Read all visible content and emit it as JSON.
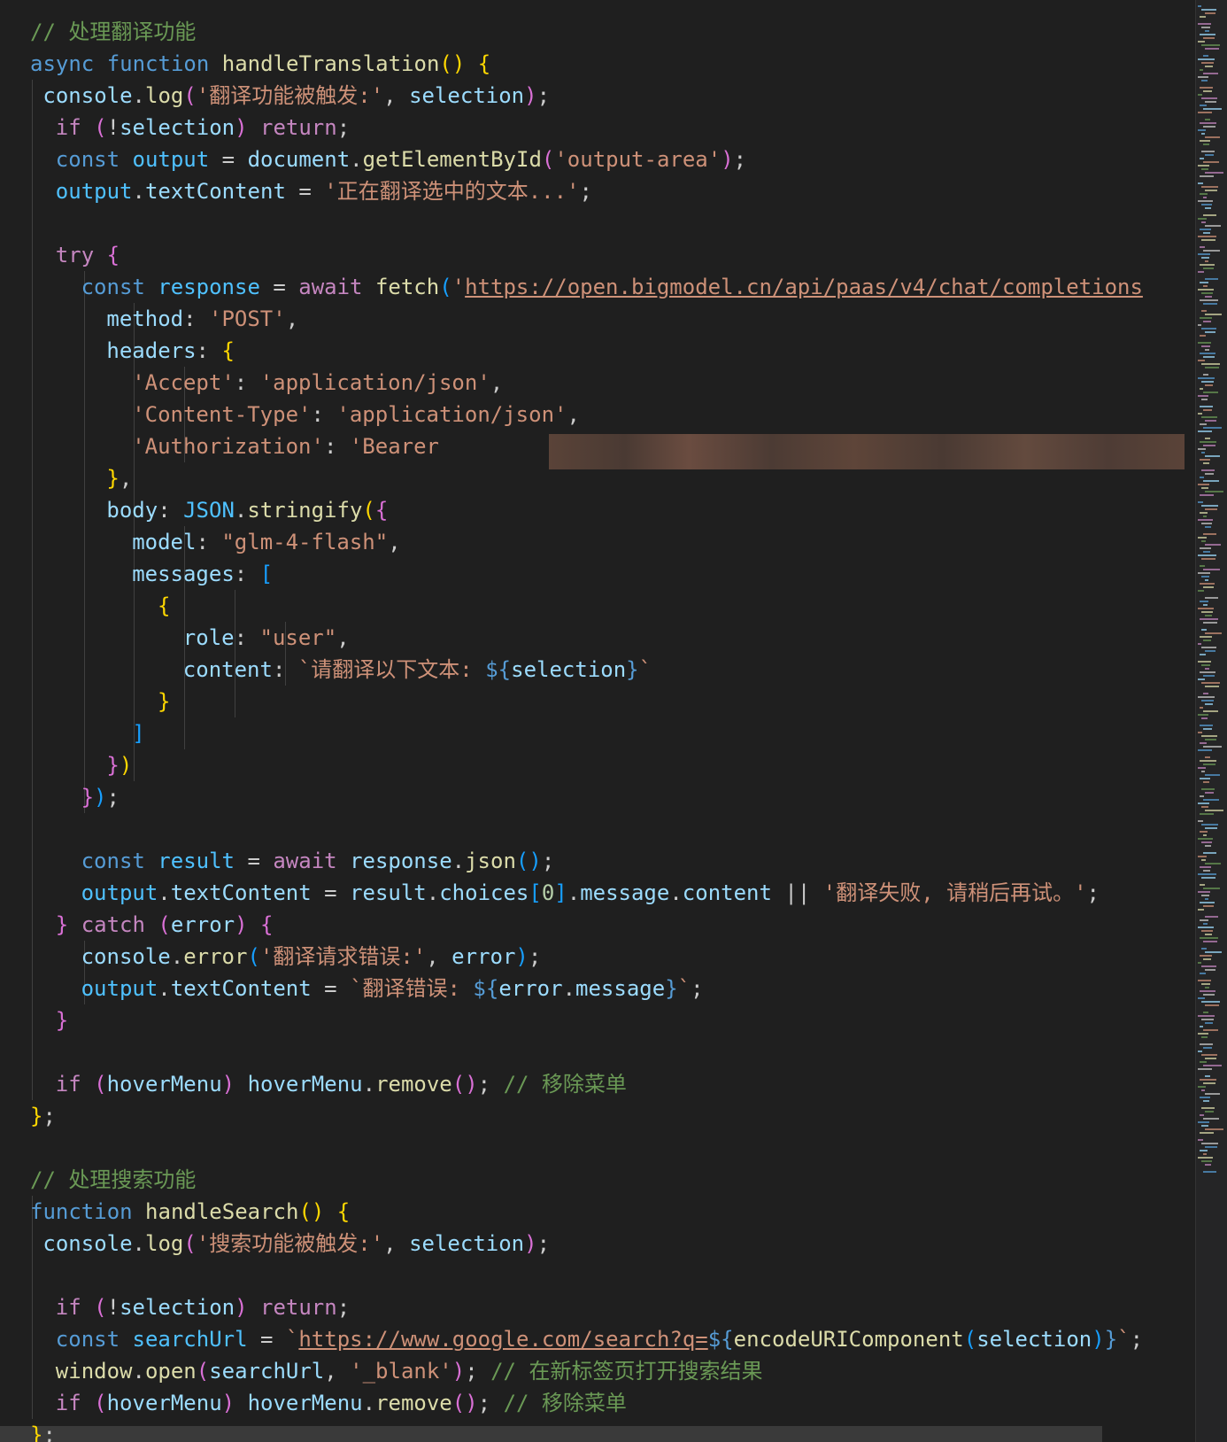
{
  "lines": [
    [
      [
        "com",
        "// 处理翻译功能"
      ]
    ],
    [
      [
        "kw",
        "async "
      ],
      [
        "kw",
        "function "
      ],
      [
        "fn",
        "handleTranslation"
      ],
      [
        "b1",
        "() {"
      ]
    ],
    [
      [
        "var",
        "console"
      ],
      [
        "p",
        "."
      ],
      [
        "fn",
        "log"
      ],
      [
        "b2",
        "("
      ],
      [
        "str",
        "'翻译功能被触发:'"
      ],
      [
        "p",
        ", "
      ],
      [
        "var",
        "selection"
      ],
      [
        "b2",
        ")"
      ],
      [
        "p",
        ";"
      ]
    ],
    [
      [
        "ctl",
        "if "
      ],
      [
        "b2",
        "("
      ],
      [
        "p",
        "!"
      ],
      [
        "var",
        "selection"
      ],
      [
        "b2",
        ")"
      ],
      [
        "ctl",
        " return"
      ],
      [
        "p",
        ";"
      ]
    ],
    [
      [
        "kw",
        "const "
      ],
      [
        "const",
        "output"
      ],
      [
        "p",
        " = "
      ],
      [
        "var",
        "document"
      ],
      [
        "p",
        "."
      ],
      [
        "fn",
        "getElementById"
      ],
      [
        "b2",
        "("
      ],
      [
        "str",
        "'output-area'"
      ],
      [
        "b2",
        ")"
      ],
      [
        "p",
        ";"
      ]
    ],
    [
      [
        "const",
        "output"
      ],
      [
        "p",
        "."
      ],
      [
        "var",
        "textContent"
      ],
      [
        "p",
        " = "
      ],
      [
        "str",
        "'正在翻译选中的文本...'"
      ],
      [
        "p",
        ";"
      ]
    ],
    [],
    [
      [
        "ctl",
        "try "
      ],
      [
        "b2",
        "{"
      ]
    ],
    [
      [
        "kw",
        "const "
      ],
      [
        "const",
        "response"
      ],
      [
        "p",
        " = "
      ],
      [
        "ctl",
        "await "
      ],
      [
        "fn",
        "fetch"
      ],
      [
        "b3",
        "("
      ],
      [
        "str",
        "'"
      ],
      [
        "url",
        "https://open.bigmodel.cn/api/paas/v4/chat/completions"
      ]
    ],
    [
      [
        "var",
        "method"
      ],
      [
        "p",
        ": "
      ],
      [
        "str",
        "'POST'"
      ],
      [
        "p",
        ","
      ]
    ],
    [
      [
        "var",
        "headers"
      ],
      [
        "p",
        ": "
      ],
      [
        "b1",
        "{"
      ]
    ],
    [
      [
        "str",
        "'Accept'"
      ],
      [
        "p",
        ": "
      ],
      [
        "str",
        "'application/json'"
      ],
      [
        "p",
        ","
      ]
    ],
    [
      [
        "str",
        "'Content-Type'"
      ],
      [
        "p",
        ": "
      ],
      [
        "str",
        "'application/json'"
      ],
      [
        "p",
        ","
      ]
    ],
    [
      [
        "str",
        "'Authorization'"
      ],
      [
        "p",
        ": "
      ],
      [
        "str",
        "'Bearer "
      ]
    ],
    [
      [
        "b1",
        "}"
      ],
      [
        "p",
        ","
      ]
    ],
    [
      [
        "var",
        "body"
      ],
      [
        "p",
        ": "
      ],
      [
        "const",
        "JSON"
      ],
      [
        "p",
        "."
      ],
      [
        "fn",
        "stringify"
      ],
      [
        "b1",
        "("
      ],
      [
        "b2",
        "{"
      ]
    ],
    [
      [
        "var",
        "model"
      ],
      [
        "p",
        ": "
      ],
      [
        "str",
        "\"glm-4-flash\""
      ],
      [
        "p",
        ","
      ]
    ],
    [
      [
        "var",
        "messages"
      ],
      [
        "p",
        ": "
      ],
      [
        "b3",
        "["
      ]
    ],
    [
      [
        "b1",
        "{"
      ]
    ],
    [
      [
        "var",
        "role"
      ],
      [
        "p",
        ": "
      ],
      [
        "str",
        "\"user\""
      ],
      [
        "p",
        ","
      ]
    ],
    [
      [
        "var",
        "content"
      ],
      [
        "p",
        ": "
      ],
      [
        "str",
        "`请翻译以下文本: "
      ],
      [
        "interp",
        "${"
      ],
      [
        "var",
        "selection"
      ],
      [
        "interp",
        "}"
      ],
      [
        "str",
        "`"
      ]
    ],
    [
      [
        "b1",
        "}"
      ]
    ],
    [
      [
        "b3",
        "]"
      ]
    ],
    [
      [
        "b2",
        "}"
      ],
      [
        "b1",
        ")"
      ]
    ],
    [
      [
        "b2",
        "}"
      ],
      [
        "b3",
        ")"
      ],
      [
        "p",
        ";"
      ]
    ],
    [],
    [
      [
        "kw",
        "const "
      ],
      [
        "const",
        "result"
      ],
      [
        "p",
        " = "
      ],
      [
        "ctl",
        "await "
      ],
      [
        "var",
        "response"
      ],
      [
        "p",
        "."
      ],
      [
        "fn",
        "json"
      ],
      [
        "b3",
        "()"
      ],
      [
        "p",
        ";"
      ]
    ],
    [
      [
        "const",
        "output"
      ],
      [
        "p",
        "."
      ],
      [
        "var",
        "textContent"
      ],
      [
        "p",
        " = "
      ],
      [
        "var",
        "result"
      ],
      [
        "p",
        "."
      ],
      [
        "var",
        "choices"
      ],
      [
        "b3",
        "["
      ],
      [
        "num",
        "0"
      ],
      [
        "b3",
        "]"
      ],
      [
        "p",
        "."
      ],
      [
        "var",
        "message"
      ],
      [
        "p",
        "."
      ],
      [
        "var",
        "content"
      ],
      [
        "p",
        " || "
      ],
      [
        "str",
        "'翻译失败, 请稍后再试。'"
      ],
      [
        "p",
        ";"
      ]
    ],
    [
      [
        "b2",
        "} "
      ],
      [
        "ctl",
        "catch "
      ],
      [
        "b2",
        "("
      ],
      [
        "var",
        "error"
      ],
      [
        "b2",
        ") {"
      ]
    ],
    [
      [
        "var",
        "console"
      ],
      [
        "p",
        "."
      ],
      [
        "fn",
        "error"
      ],
      [
        "b3",
        "("
      ],
      [
        "str",
        "'翻译请求错误:'"
      ],
      [
        "p",
        ", "
      ],
      [
        "var",
        "error"
      ],
      [
        "b3",
        ")"
      ],
      [
        "p",
        ";"
      ]
    ],
    [
      [
        "const",
        "output"
      ],
      [
        "p",
        "."
      ],
      [
        "var",
        "textContent"
      ],
      [
        "p",
        " = "
      ],
      [
        "str",
        "`翻译错误: "
      ],
      [
        "interp",
        "${"
      ],
      [
        "var",
        "error"
      ],
      [
        "p",
        "."
      ],
      [
        "var",
        "message"
      ],
      [
        "interp",
        "}"
      ],
      [
        "str",
        "`"
      ],
      [
        "p",
        ";"
      ]
    ],
    [
      [
        "b2",
        "}"
      ]
    ],
    [],
    [
      [
        "ctl",
        "if "
      ],
      [
        "b2",
        "("
      ],
      [
        "var",
        "hoverMenu"
      ],
      [
        "b2",
        ")"
      ],
      [
        "p",
        " "
      ],
      [
        "var",
        "hoverMenu"
      ],
      [
        "p",
        "."
      ],
      [
        "fn",
        "remove"
      ],
      [
        "b2",
        "()"
      ],
      [
        "p",
        "; "
      ],
      [
        "com",
        "// 移除菜单"
      ]
    ],
    [
      [
        "b1",
        "}"
      ],
      [
        "p",
        ";"
      ]
    ],
    [],
    [
      [
        "com",
        "// 处理搜索功能"
      ]
    ],
    [
      [
        "kw",
        "function "
      ],
      [
        "fn",
        "handleSearch"
      ],
      [
        "b1",
        "() {"
      ]
    ],
    [
      [
        "var",
        "console"
      ],
      [
        "p",
        "."
      ],
      [
        "fn",
        "log"
      ],
      [
        "b2",
        "("
      ],
      [
        "str",
        "'搜索功能被触发:'"
      ],
      [
        "p",
        ", "
      ],
      [
        "var",
        "selection"
      ],
      [
        "b2",
        ")"
      ],
      [
        "p",
        ";"
      ]
    ],
    [],
    [
      [
        "ctl",
        "if "
      ],
      [
        "b2",
        "("
      ],
      [
        "p",
        "!"
      ],
      [
        "var",
        "selection"
      ],
      [
        "b2",
        ")"
      ],
      [
        "ctl",
        " return"
      ],
      [
        "p",
        ";"
      ]
    ],
    [
      [
        "kw",
        "const "
      ],
      [
        "const",
        "searchUrl"
      ],
      [
        "p",
        " = "
      ],
      [
        "str",
        "`"
      ],
      [
        "url",
        "https://www.google.com/search?q="
      ],
      [
        "interp",
        "${"
      ],
      [
        "fn",
        "encodeURIComponent"
      ],
      [
        "b3",
        "("
      ],
      [
        "var",
        "selection"
      ],
      [
        "b3",
        ")"
      ],
      [
        "interp",
        "}"
      ],
      [
        "str",
        "`"
      ],
      [
        "p",
        ";"
      ]
    ],
    [
      [
        "fn",
        "window"
      ],
      [
        "p",
        "."
      ],
      [
        "fn",
        "open"
      ],
      [
        "b2",
        "("
      ],
      [
        "var",
        "searchUrl"
      ],
      [
        "p",
        ", "
      ],
      [
        "str",
        "'_blank'"
      ],
      [
        "b2",
        ")"
      ],
      [
        "p",
        "; "
      ],
      [
        "com",
        "// 在新标签页打开搜索结果"
      ]
    ],
    [
      [
        "ctl",
        "if "
      ],
      [
        "b2",
        "("
      ],
      [
        "var",
        "hoverMenu"
      ],
      [
        "b2",
        ")"
      ],
      [
        "p",
        " "
      ],
      [
        "var",
        "hoverMenu"
      ],
      [
        "p",
        "."
      ],
      [
        "fn",
        "remove"
      ],
      [
        "b2",
        "()"
      ],
      [
        "p",
        "; "
      ],
      [
        "com",
        "// 移除菜单"
      ]
    ],
    [
      [
        "b1",
        "}"
      ],
      [
        "p",
        ";"
      ]
    ]
  ]
}
